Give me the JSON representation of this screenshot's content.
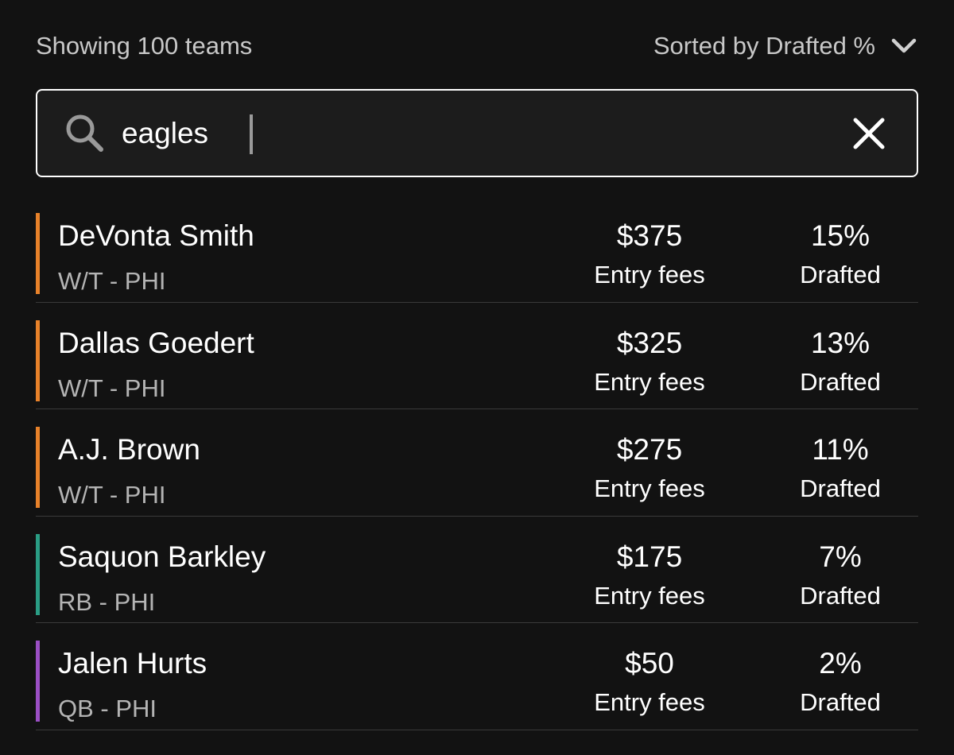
{
  "header": {
    "showing_label": "Showing 100 teams",
    "sort_label": "Sorted by Drafted %"
  },
  "search": {
    "value": "eagles",
    "placeholder": ""
  },
  "players": [
    {
      "name": "DeVonta Smith",
      "position": "W/T - PHI",
      "fee": "$375",
      "fee_label": "Entry fees",
      "pct": "15%",
      "pct_label": "Drafted",
      "color": "#e8822a"
    },
    {
      "name": "Dallas Goedert",
      "position": "W/T - PHI",
      "fee": "$325",
      "fee_label": "Entry fees",
      "pct": "13%",
      "pct_label": "Drafted",
      "color": "#e8822a"
    },
    {
      "name": "A.J. Brown",
      "position": "W/T - PHI",
      "fee": "$275",
      "fee_label": "Entry fees",
      "pct": "11%",
      "pct_label": "Drafted",
      "color": "#e8822a"
    },
    {
      "name": "Saquon Barkley",
      "position": "RB - PHI",
      "fee": "$175",
      "fee_label": "Entry fees",
      "pct": "7%",
      "pct_label": "Drafted",
      "color": "#2a9d84"
    },
    {
      "name": "Jalen Hurts",
      "position": "QB - PHI",
      "fee": "$50",
      "fee_label": "Entry fees",
      "pct": "2%",
      "pct_label": "Drafted",
      "color": "#9b4fc4"
    }
  ]
}
